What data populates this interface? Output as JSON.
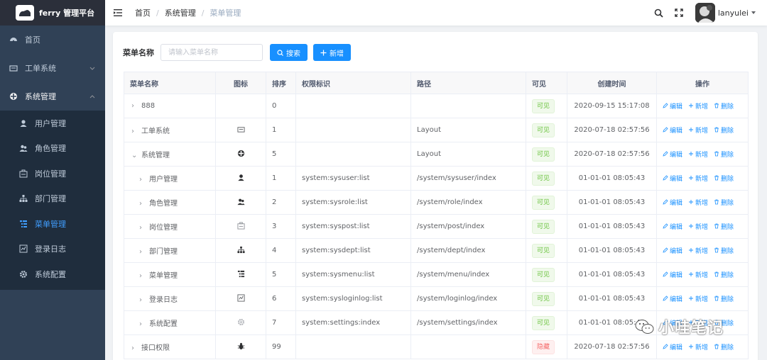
{
  "app": {
    "title": "ferry 管理平台"
  },
  "sidebar": {
    "items": [
      {
        "label": "首页",
        "icon": "dashboard-icon"
      },
      {
        "label": "工单系统",
        "icon": "ticket-icon"
      },
      {
        "label": "系统管理",
        "icon": "system-icon"
      }
    ],
    "sub_items": [
      {
        "label": "用户管理",
        "icon": "user-icon"
      },
      {
        "label": "角色管理",
        "icon": "users-icon"
      },
      {
        "label": "岗位管理",
        "icon": "post-icon"
      },
      {
        "label": "部门管理",
        "icon": "tree-icon"
      },
      {
        "label": "菜单管理",
        "icon": "menu-list-icon"
      },
      {
        "label": "登录日志",
        "icon": "log-icon"
      },
      {
        "label": "系统配置",
        "icon": "gear-icon"
      }
    ]
  },
  "navbar": {
    "breadcrumb": [
      "首页",
      "系统管理",
      "菜单管理"
    ],
    "username": "lanyulei"
  },
  "search": {
    "label": "菜单名称",
    "placeholder": "请输入菜单名称",
    "search_button": "搜索",
    "add_button": "新增"
  },
  "table": {
    "headers": [
      "菜单名称",
      "图标",
      "排序",
      "权限标识",
      "路径",
      "可见",
      "创建时间",
      "操作"
    ],
    "actions": {
      "edit": "编辑",
      "add": "新增",
      "delete": "删除"
    },
    "rows": [
      {
        "name": "888",
        "expand": "›",
        "icon": "",
        "sort": "0",
        "perm": "",
        "path": "",
        "visible": "可见",
        "visible_state": "visible",
        "created": "2020-09-15 15:17:08",
        "indent": 0
      },
      {
        "name": "工单系统",
        "expand": "›",
        "icon": "ticket-icon",
        "sort": "1",
        "perm": "",
        "path": "Layout",
        "visible": "可见",
        "visible_state": "visible",
        "created": "2020-07-18 02:57:56",
        "indent": 0
      },
      {
        "name": "系统管理",
        "expand": "⌄",
        "icon": "system-icon",
        "sort": "5",
        "perm": "",
        "path": "Layout",
        "visible": "可见",
        "visible_state": "visible",
        "created": "2020-07-18 02:57:56",
        "indent": 0
      },
      {
        "name": "用户管理",
        "expand": "›",
        "icon": "user-icon",
        "sort": "1",
        "perm": "system:sysuser:list",
        "path": "/system/sysuser/index",
        "visible": "可见",
        "visible_state": "visible",
        "created": "01-01-01 08:05:43",
        "indent": 1
      },
      {
        "name": "角色管理",
        "expand": "›",
        "icon": "users-icon",
        "sort": "2",
        "perm": "system:sysrole:list",
        "path": "/system/role/index",
        "visible": "可见",
        "visible_state": "visible",
        "created": "01-01-01 08:05:43",
        "indent": 1
      },
      {
        "name": "岗位管理",
        "expand": "›",
        "icon": "post-icon",
        "sort": "3",
        "perm": "system:syspost:list",
        "path": "/system/post/index",
        "visible": "可见",
        "visible_state": "visible",
        "created": "01-01-01 08:05:43",
        "indent": 1
      },
      {
        "name": "部门管理",
        "expand": "›",
        "icon": "tree-icon",
        "sort": "4",
        "perm": "system:sysdept:list",
        "path": "/system/dept/index",
        "visible": "可见",
        "visible_state": "visible",
        "created": "01-01-01 08:05:43",
        "indent": 1
      },
      {
        "name": "菜单管理",
        "expand": "›",
        "icon": "menu-list-icon",
        "sort": "5",
        "perm": "system:sysmenu:list",
        "path": "/system/menu/index",
        "visible": "可见",
        "visible_state": "visible",
        "created": "01-01-01 08:05:43",
        "indent": 1
      },
      {
        "name": "登录日志",
        "expand": "›",
        "icon": "log-icon",
        "sort": "6",
        "perm": "system:sysloginlog:list",
        "path": "/system/loginlog/index",
        "visible": "可见",
        "visible_state": "visible",
        "created": "01-01-01 08:05:43",
        "indent": 1
      },
      {
        "name": "系统配置",
        "expand": "›",
        "icon": "gear-icon",
        "sort": "7",
        "perm": "system:settings:index",
        "path": "/system/settings/index",
        "visible": "可见",
        "visible_state": "visible",
        "created": "01-01-01 08:05:43",
        "indent": 1
      },
      {
        "name": "接口权限",
        "expand": "›",
        "icon": "bug-icon",
        "sort": "99",
        "perm": "",
        "path": "",
        "visible": "隐藏",
        "visible_state": "hidden",
        "created": "2020-07-18 02:57:56",
        "indent": 0
      }
    ]
  },
  "watermark": {
    "text": "小哇笔记",
    "icon": "wechat-icon"
  },
  "colors": {
    "sidebar_bg": "#304156",
    "submenu_bg": "#1f2d3d",
    "primary": "#1890ff",
    "active_menu": "#409eff",
    "success": "#67c23a",
    "danger": "#f56c6c"
  }
}
